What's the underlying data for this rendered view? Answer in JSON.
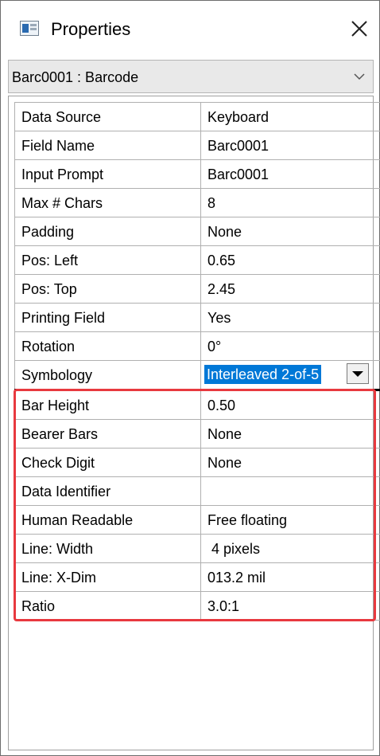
{
  "window": {
    "title": "Properties",
    "icon": "properties-window-icon",
    "close_icon": "close-icon"
  },
  "object_selector": {
    "value": "Barc0001 : Barcode",
    "icon": "chevron-down-icon"
  },
  "properties": [
    {
      "name": "Data Source",
      "value": "Keyboard"
    },
    {
      "name": "Field Name",
      "value": "Barc0001"
    },
    {
      "name": "Input Prompt",
      "value": "Barc0001"
    },
    {
      "name": "Max # Chars",
      "value": "8"
    },
    {
      "name": "Padding",
      "value": "None"
    },
    {
      "name": "Pos: Left",
      "value": "0.65"
    },
    {
      "name": "Pos: Top",
      "value": "2.45"
    },
    {
      "name": "Printing Field",
      "value": "Yes"
    },
    {
      "name": "Rotation",
      "value": "0°"
    },
    {
      "name": "Symbology",
      "value": "Interleaved 2-of-5"
    },
    {
      "name": "Bar Height",
      "value": "0.50"
    },
    {
      "name": "Bearer Bars",
      "value": "None"
    },
    {
      "name": "Check Digit",
      "value": "None"
    },
    {
      "name": "Data Identifier",
      "value": ""
    },
    {
      "name": "Human Readable",
      "value": "Free floating"
    },
    {
      "name": "Line:  Width",
      "value": " 4 pixels"
    },
    {
      "name": "Line: X-Dim",
      "value": "013.2 mil"
    },
    {
      "name": "Ratio",
      "value": "3.0:1"
    }
  ],
  "colors": {
    "highlight_border": "#e8393f",
    "selection": "#0078d7"
  }
}
